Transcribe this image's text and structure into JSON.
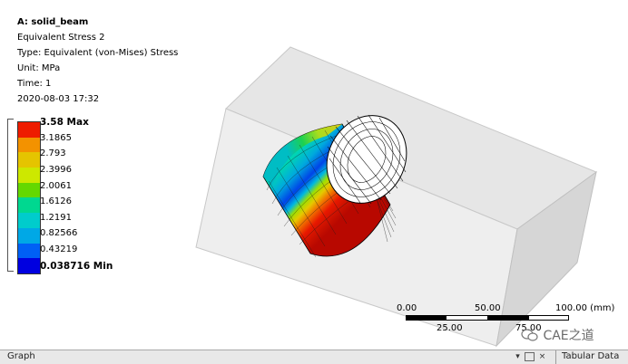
{
  "info": {
    "title": "A: solid_beam",
    "result_name": "Equivalent Stress 2",
    "type_line": "Type: Equivalent (von-Mises) Stress",
    "unit_line": "Unit: MPa",
    "time_line": "Time: 1",
    "date_line": "2020-08-03 17:32"
  },
  "legend": {
    "max_label": "3.58 Max",
    "min_label": "0.038716 Min",
    "levels": [
      "3.1865",
      "2.793",
      "2.3996",
      "2.0061",
      "1.6126",
      "1.2191",
      "0.82566",
      "0.43219"
    ],
    "colors": [
      "#ee1c00",
      "#f39200",
      "#e5c400",
      "#cde800",
      "#64d800",
      "#00d890",
      "#00cccc",
      "#00a8e6",
      "#0060f5",
      "#0000e0"
    ]
  },
  "scale": {
    "ticks_top": [
      "0.00",
      "50.00",
      "100.00 (mm)"
    ],
    "ticks_bottom": [
      "25.00",
      "75.00"
    ]
  },
  "bottom": {
    "graph_tab": "Graph",
    "tabular_tab": "Tabular Data"
  },
  "watermark": "CAE之道"
}
